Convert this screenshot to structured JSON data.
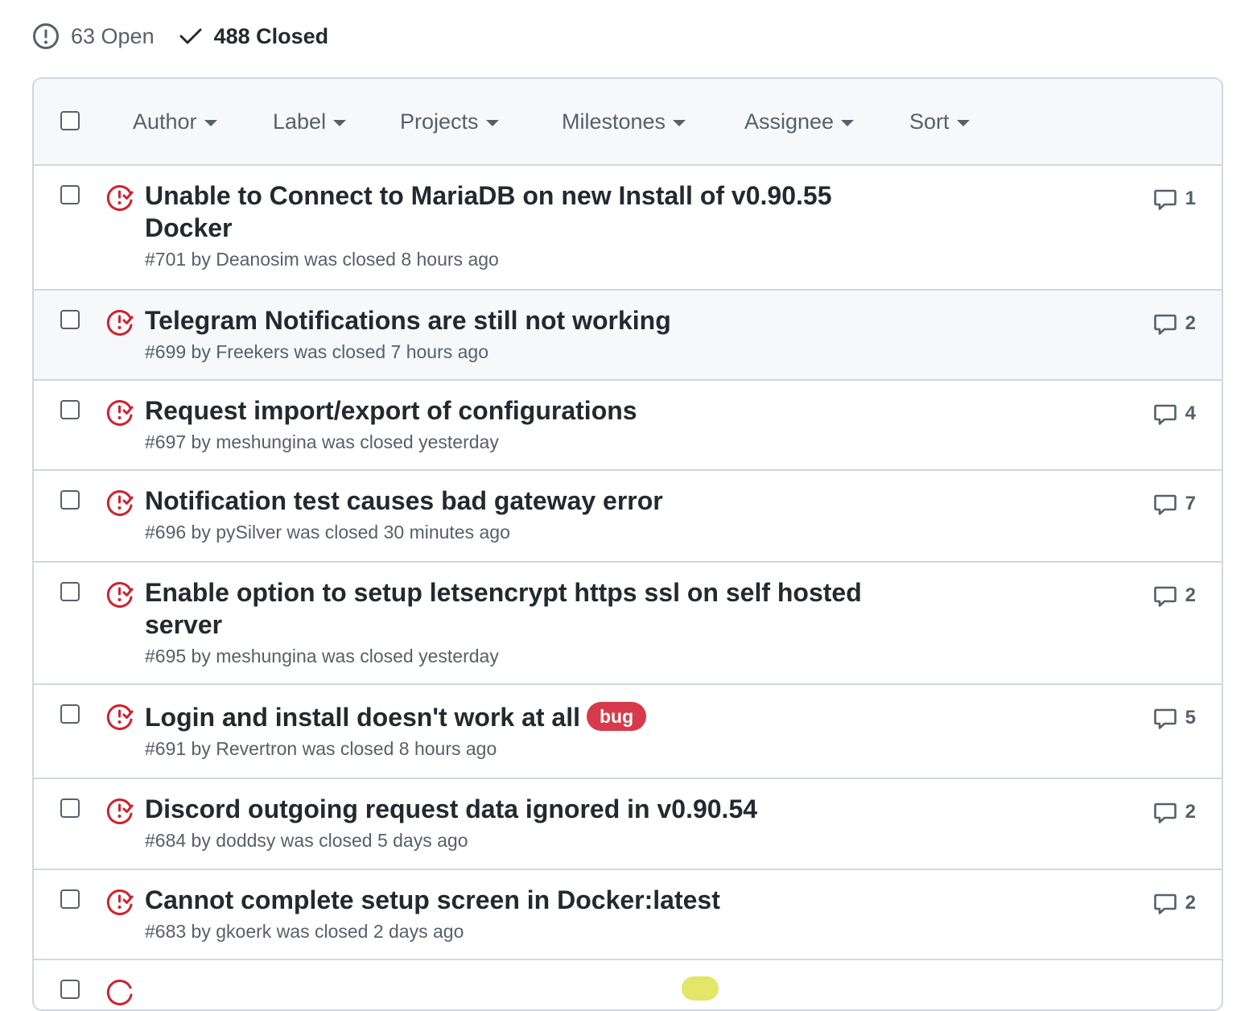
{
  "states": {
    "open_label": "63 Open",
    "closed_label": "488 Closed"
  },
  "filters": {
    "author": "Author",
    "label": "Label",
    "projects": "Projects",
    "milestones": "Milestones",
    "assignee": "Assignee",
    "sort": "Sort"
  },
  "colors": {
    "closed_icon": "#cf222e",
    "bug_label": "#d73a4a"
  },
  "issues": [
    {
      "title": "Unable to Connect to MariaDB on new Install of v0.90.55 Docker",
      "meta": "#701 by Deanosim was closed 8 hours ago",
      "comments": "1"
    },
    {
      "title": "Telegram Notifications are still not working",
      "meta": "#699 by Freekers was closed 7 hours ago",
      "comments": "2"
    },
    {
      "title": "Request import/export of configurations",
      "meta": "#697 by meshungina was closed yesterday",
      "comments": "4"
    },
    {
      "title": "Notification test causes bad gateway error",
      "meta": "#696 by pySilver was closed 30 minutes ago",
      "comments": "7"
    },
    {
      "title": "Enable option to setup letsencrypt https ssl on self hosted server",
      "meta": "#695 by meshungina was closed yesterday",
      "comments": "2"
    },
    {
      "title": "Login and install doesn't work at all",
      "label": "bug",
      "meta": "#691 by Revertron was closed 8 hours ago",
      "comments": "5"
    },
    {
      "title": "Discord outgoing request data ignored in v0.90.54",
      "meta": "#684 by doddsy was closed 5 days ago",
      "comments": "2"
    },
    {
      "title": "Cannot complete setup screen in Docker:latest",
      "meta": "#683 by gkoerk was closed 2 days ago",
      "comments": "2"
    }
  ]
}
